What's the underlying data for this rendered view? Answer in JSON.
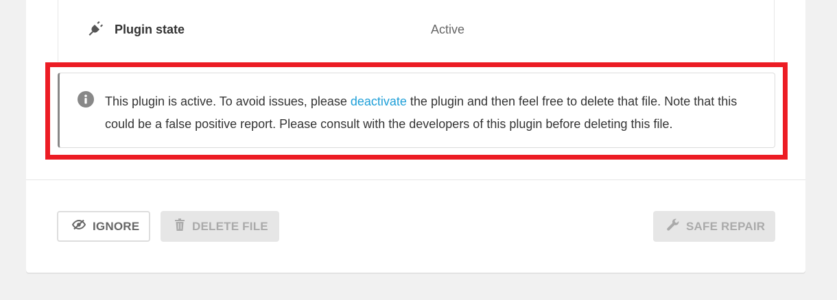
{
  "plugin_state": {
    "label": "Plugin state",
    "value": "Active",
    "icon": "plug-icon"
  },
  "notice": {
    "icon": "info-icon",
    "text_before": "This plugin is active. To avoid issues, please ",
    "link_text": "deactivate",
    "text_after": " the plugin and then feel free to delete that file. Note that this could be a false positive report. Please consult with the developers of this plugin before deleting this file.",
    "link_color": "#1e9fd8"
  },
  "highlight_color": "#ec1c24",
  "buttons": {
    "ignore": {
      "label": "Ignore",
      "icon": "eye-slash-icon"
    },
    "delete": {
      "label": "Delete file",
      "icon": "trash-icon"
    },
    "repair": {
      "label": "Safe repair",
      "icon": "wrench-icon"
    }
  }
}
